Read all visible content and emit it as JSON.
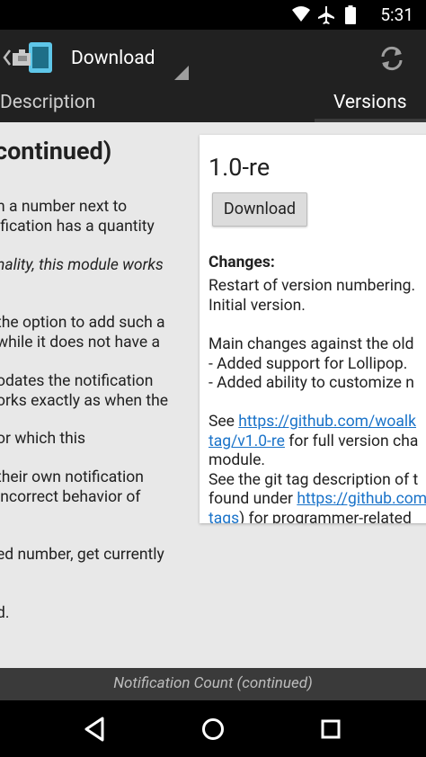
{
  "status_bar": {
    "time": "5:31"
  },
  "app_bar": {
    "title": "Download"
  },
  "tabs": [
    {
      "label": "Description"
    },
    {
      "label": "Versions"
    }
  ],
  "description": {
    "heading": "continued)",
    "lines": [
      {
        "text": "n a number next to",
        "italic": false
      },
      {
        "text": "ification has a quantity",
        "italic": false
      },
      {
        "text": "nality, this module works",
        "italic": true
      },
      {
        "text": "the option to add such a",
        "italic": false
      },
      {
        "text": "while it does not have a",
        "italic": false
      },
      {
        "text": "odates the notification",
        "italic": false
      },
      {
        "text": "orks exactly as when the",
        "italic": false
      },
      {
        "text": "or which this",
        "italic": false
      },
      {
        "text": "their own notification",
        "italic": false
      },
      {
        "text": "incorrect behavior of",
        "italic": false
      },
      {
        "text": "ed number, get currently",
        "italic": false
      },
      {
        "text": "d.",
        "italic": false
      }
    ]
  },
  "version_card": {
    "version": "1.0-re",
    "download_label": "Download",
    "changes_label": "Changes:",
    "lines": {
      "l1": "Restart of version numbering.",
      "l2": "Initial version.",
      "l3": "Main changes against the old",
      "l4": "- Added support for Lollipop.",
      "l5": "- Added ability to customize n",
      "l6_pre": "See ",
      "l6_link": "https://github.com/woalk",
      "l7_link": "tag/v1.0-re",
      "l7_post": " for full version cha",
      "l8": "module.",
      "l9": "See the git tag description of t",
      "l10_pre": "found under ",
      "l10_link": "https://github.com",
      "l11_link": "tags",
      "l11_post": ") for programmer-related"
    }
  },
  "footer": {
    "text": "Notification Count (continued)"
  }
}
